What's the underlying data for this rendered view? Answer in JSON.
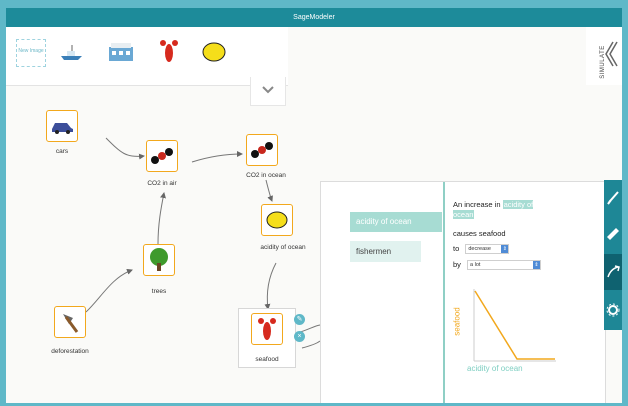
{
  "app": {
    "title": "SageModeler"
  },
  "toolbar": {
    "add_image_label": "New Image",
    "simulate_label": "SIMULATE"
  },
  "nodes": {
    "cars": "cars",
    "co2_air": "CO2 in air",
    "co2_ocean": "CO2 in ocean",
    "acidity": "acidity of ocean",
    "trees": "trees",
    "deforestation": "deforestation",
    "seafood": "seafood"
  },
  "relationship": {
    "items": [
      "acidity of ocean",
      "fishermen"
    ],
    "sentence_prefix": "An increase in",
    "source": "acidity of ocean",
    "causes": "causes seafood",
    "to_label": "to",
    "direction": "decrease",
    "by_label": "by",
    "amount": "a lot",
    "graph_y": "seafood",
    "graph_x": "acidity of ocean"
  },
  "colors": {
    "topbar": "#1d8b9a",
    "node_border": "#f2a81d",
    "highlight": "#a7dcd3",
    "graph_line": "#f2a81d",
    "axis_label": "#7fcfc2"
  }
}
